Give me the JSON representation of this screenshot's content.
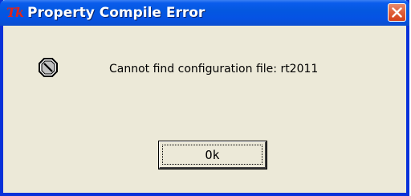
{
  "window": {
    "title": "Property Compile Error",
    "app_logo_text": "Tk"
  },
  "dialog": {
    "message": "Cannot find configuration file: rt2011",
    "icon": "error-stop-icon",
    "ok_label": "Ok"
  },
  "colors": {
    "titlebar": "#0553e4",
    "frame": "#0831d9",
    "body": "#ece9d8",
    "close_button": "#e0623d",
    "logo": "#e2231a"
  }
}
